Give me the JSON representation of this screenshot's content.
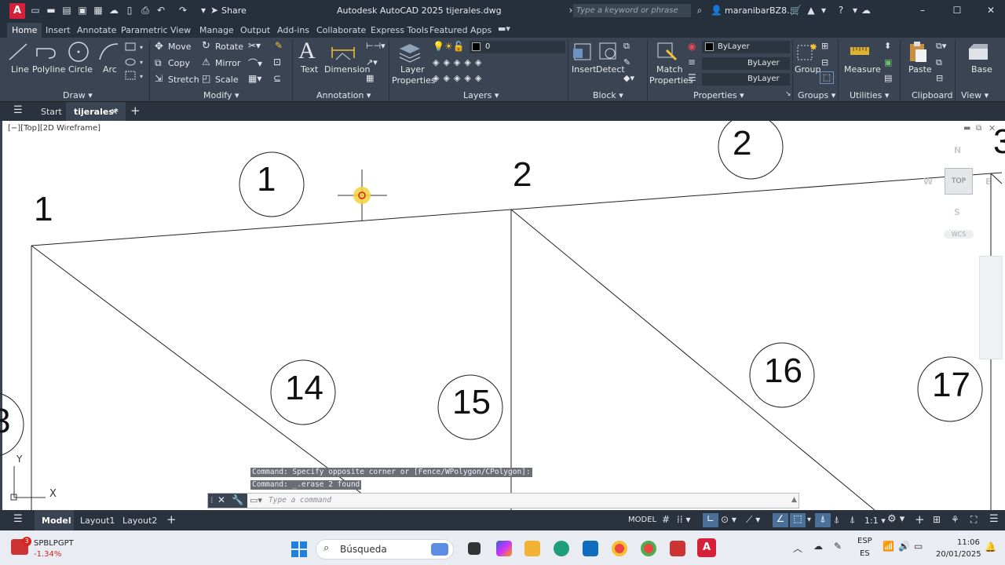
{
  "titlebar": {
    "app_logo": "A",
    "title": "Autodesk AutoCAD 2025    tijerales.dwg",
    "share": "Share",
    "search_placeholder": "Type a keyword or phrase",
    "username": "maranibarBZ8..."
  },
  "ribbon_tabs": [
    "Home",
    "Insert",
    "Annotate",
    "Parametric",
    "View",
    "Manage",
    "Output",
    "Add-ins",
    "Collaborate",
    "Express Tools",
    "Featured Apps"
  ],
  "ribbon": {
    "draw": {
      "line": "Line",
      "polyline": "Polyline",
      "circle": "Circle",
      "arc": "Arc",
      "panel": "Draw"
    },
    "modify": {
      "move": "Move",
      "rotate": "Rotate",
      "copy": "Copy",
      "mirror": "Mirror",
      "stretch": "Stretch",
      "scale": "Scale",
      "panel": "Modify"
    },
    "annotation": {
      "text": "Text",
      "dimension": "Dimension",
      "panel": "Annotation"
    },
    "layers": {
      "layer_properties_1": "Layer",
      "layer_properties_2": "Properties",
      "current_layer": "0",
      "panel": "Layers"
    },
    "block": {
      "insert": "Insert",
      "detect": "Detect",
      "panel": "Block"
    },
    "properties": {
      "match_1": "Match",
      "match_2": "Properties",
      "color": "ByLayer",
      "linetype": "ByLayer",
      "lineweight": "ByLayer",
      "panel": "Properties"
    },
    "groups": {
      "group": "Group",
      "panel": "Groups"
    },
    "utilities": {
      "measure": "Measure",
      "panel": "Utilities"
    },
    "clipboard": {
      "paste": "Paste",
      "panel": "Clipboard"
    },
    "view": {
      "base": "Base",
      "panel": "View"
    }
  },
  "file_tabs": {
    "start": "Start",
    "active": "tijerales*"
  },
  "viewport_label": "[−][Top][2D Wireframe]",
  "viewcube": {
    "n": "N",
    "w": "W",
    "e": "E",
    "s": "S",
    "top": "TOP",
    "wcs": "WCS"
  },
  "drawing_labels": {
    "node_1": "1",
    "node_2": "2",
    "node_3_partial": "3",
    "circle_1": "1",
    "circle_2": "2",
    "circle_14": "14",
    "circle_15": "15",
    "circle_16": "16",
    "circle_17": "17",
    "circle_13_partial": "3",
    "ucs_x": "X",
    "ucs_y": "Y"
  },
  "command_history": [
    "Command: Specify opposite corner or [Fence/WPolygon/CPolygon]:",
    "Command: _.erase 2 found"
  ],
  "command_prompt": "Type a command",
  "status": {
    "model_tab": "Model",
    "layout1": "Layout1",
    "layout2": "Layout2",
    "model_button": "MODEL",
    "scale": "1:1"
  },
  "taskbar": {
    "stock_name": "SPBLPGPT",
    "stock_change": "-1.34%",
    "stock_badge": "3",
    "search_label": "Búsqueda",
    "lang_1": "ESP",
    "lang_2": "ES",
    "time": "11:06",
    "date": "20/01/2025"
  },
  "colors": {
    "titlebar": "#26303c",
    "ribbon": "#3b4453",
    "accent": "#d6203a",
    "cursor": "#e8c21c"
  }
}
